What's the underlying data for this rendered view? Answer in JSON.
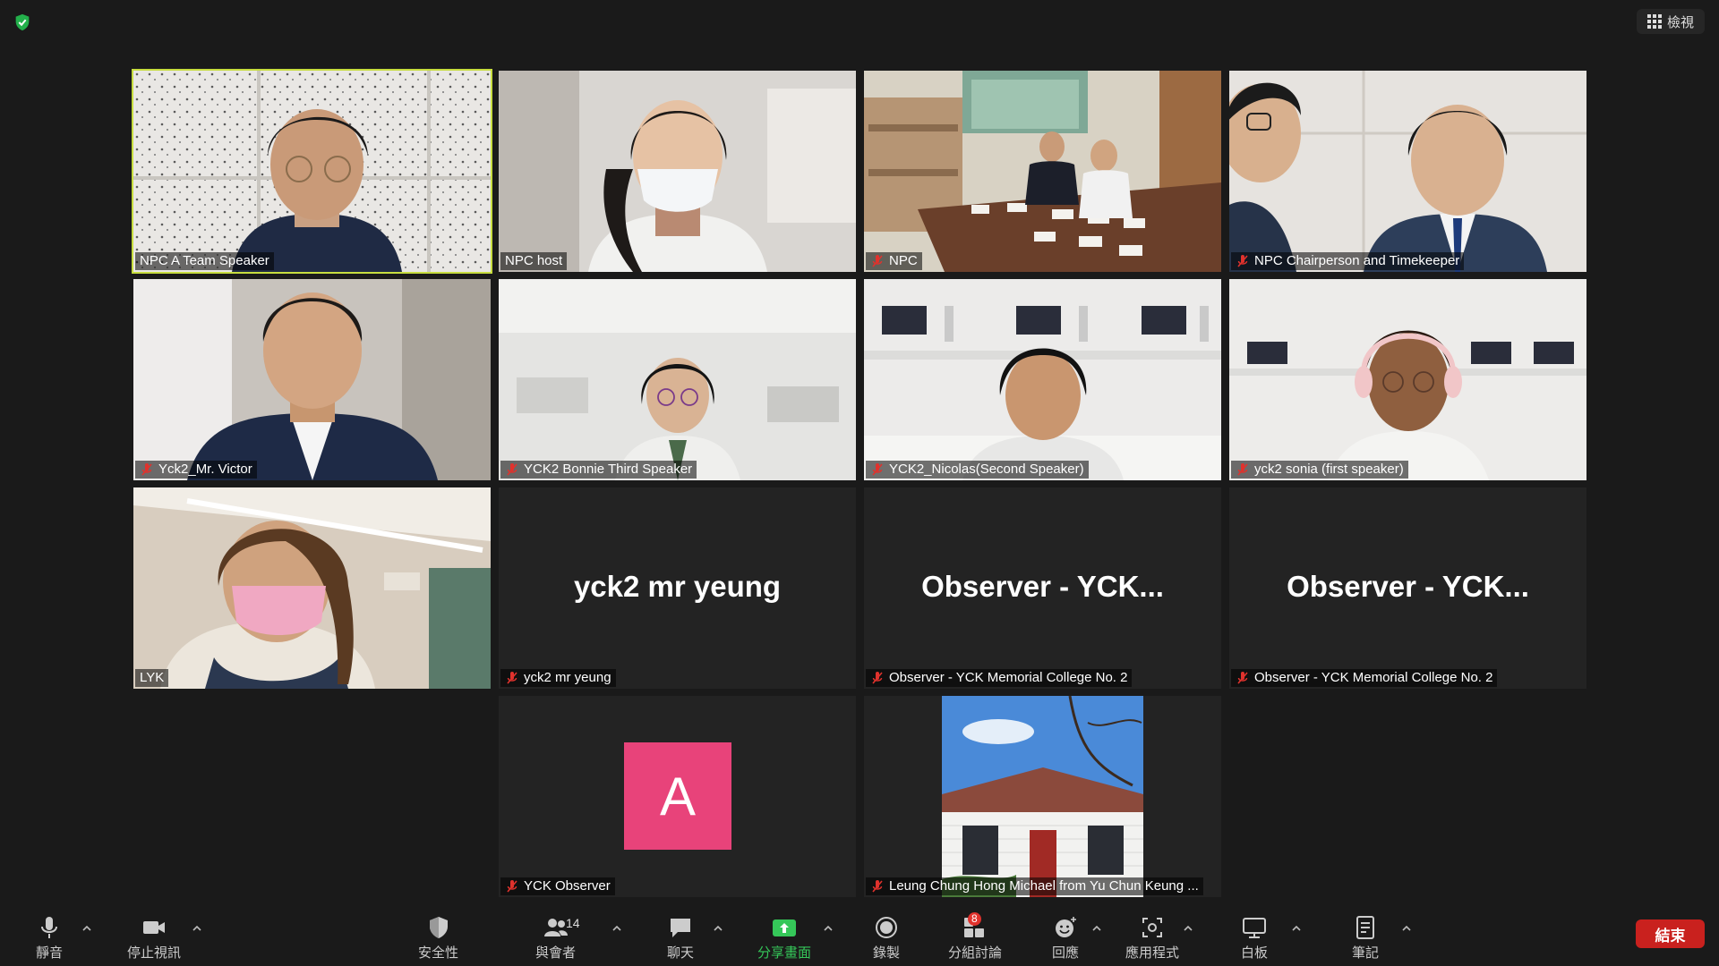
{
  "top": {
    "view_label": "檢視"
  },
  "participants": [
    {
      "name": "NPC A Team Speaker",
      "muted": false
    },
    {
      "name": "NPC host",
      "muted": false
    },
    {
      "name": "NPC",
      "muted": true
    },
    {
      "name": "NPC Chairperson and Timekeeper",
      "muted": true
    },
    {
      "name": "Yck2_Mr. Victor",
      "muted": true
    },
    {
      "name": "YCK2 Bonnie Third Speaker",
      "muted": true
    },
    {
      "name": "YCK2_Nicolas(Second Speaker)",
      "muted": true
    },
    {
      "name": "yck2 sonia (first speaker)",
      "muted": true
    },
    {
      "name": "LYK",
      "muted": false
    },
    {
      "name": "yck2 mr yeung",
      "muted": true,
      "display": "yck2 mr yeung"
    },
    {
      "name": "Observer - YCK Memorial College No. 2",
      "muted": true,
      "display": "Observer - YCK..."
    },
    {
      "name": "Observer - YCK Memorial College No. 2",
      "muted": true,
      "display": "Observer - YCK..."
    },
    {
      "name": "YCK Observer",
      "muted": true,
      "avatar_letter": "A"
    },
    {
      "name": "Leung Chung Hong Michael from Yu Chun Keung ...",
      "muted": true
    }
  ],
  "toolbar": {
    "mute": "靜音",
    "stop_video": "停止視訊",
    "security": "安全性",
    "participants": "與會者",
    "participants_count": "14",
    "chat": "聊天",
    "share_screen": "分享畫面",
    "record": "錄製",
    "breakout": "分組討論",
    "breakout_badge": "8",
    "reactions": "回應",
    "apps": "應用程式",
    "whiteboard": "白板",
    "notes": "筆記",
    "end": "結束"
  },
  "colors": {
    "active_speaker_border": "#c7dd3f",
    "avatar_bg": "#e8437a",
    "end_button": "#c9211e",
    "share_green": "#35c759",
    "mute_red": "#e0322d"
  }
}
